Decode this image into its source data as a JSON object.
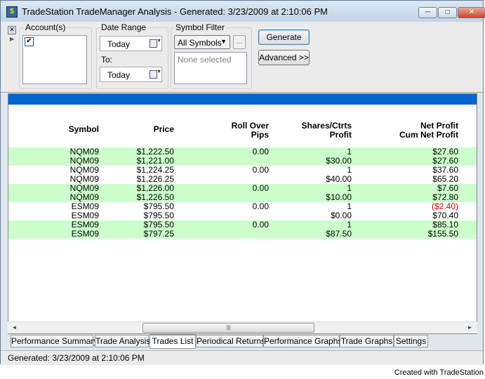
{
  "window": {
    "title": "TradeStation TradeManager Analysis - Generated: 3/23/2009 at 2:10:06 PM"
  },
  "toolbar": {
    "accounts_label": "Account(s)",
    "date_range_label": "Date Range",
    "from_value": "Today",
    "to_label": "To:",
    "to_value": "Today",
    "symbol_filter_label": "Symbol Filter",
    "symbol_filter_value": "All Symbols",
    "ellipsis_label": "...",
    "selected_text": "None selected",
    "generate_label": "Generate",
    "advanced_label": "Advanced >>"
  },
  "table": {
    "headers": [
      {
        "line1": "",
        "line2": "Symbol"
      },
      {
        "line1": "",
        "line2": "Price"
      },
      {
        "line1": "Roll Over",
        "line2": "Pips"
      },
      {
        "line1": "Shares/Ctrts",
        "line2": "Profit"
      },
      {
        "line1": "Net Profit",
        "line2": "Cum Net Profit"
      }
    ],
    "rows": [
      {
        "symbol": "NQM09",
        "price": "$1,222.50",
        "rollover": "0.00",
        "shares_profit": "1",
        "net": "$27.60",
        "green": true
      },
      {
        "symbol": "NQM09",
        "price": "$1,221.00",
        "rollover": "",
        "shares_profit": "$30.00",
        "net": "$27.60",
        "green": true
      },
      {
        "symbol": "NQM09",
        "price": "$1,224.25",
        "rollover": "0.00",
        "shares_profit": "1",
        "net": "$37.60",
        "green": false
      },
      {
        "symbol": "NQM09",
        "price": "$1,226.25",
        "rollover": "",
        "shares_profit": "$40.00",
        "net": "$65.20",
        "green": false
      },
      {
        "symbol": "NQM09",
        "price": "$1,226.00",
        "rollover": "0.00",
        "shares_profit": "1",
        "net": "$7.60",
        "green": true
      },
      {
        "symbol": "NQM09",
        "price": "$1,226.50",
        "rollover": "",
        "shares_profit": "$10.00",
        "net": "$72.80",
        "green": true
      },
      {
        "symbol": "ESM09",
        "price": "$795.50",
        "rollover": "0.00",
        "shares_profit": "1",
        "net": "($2.40)",
        "green": false,
        "negative": true
      },
      {
        "symbol": "ESM09",
        "price": "$795.50",
        "rollover": "",
        "shares_profit": "$0.00",
        "net": "$70.40",
        "green": false
      },
      {
        "symbol": "ESM09",
        "price": "$795.50",
        "rollover": "0.00",
        "shares_profit": "1",
        "net": "$85.10",
        "green": true
      },
      {
        "symbol": "ESM09",
        "price": "$797.25",
        "rollover": "",
        "shares_profit": "$87.50",
        "net": "$155.50",
        "green": true
      }
    ]
  },
  "scrollbar": {
    "left_arrow": "◄",
    "right_arrow": "►",
    "grip": "|||"
  },
  "tabs": [
    {
      "label": "Performance Summary",
      "active": false
    },
    {
      "label": "Trade Analysis",
      "active": false
    },
    {
      "label": "Trades List",
      "active": true
    },
    {
      "label": "Periodical Returns",
      "active": false
    },
    {
      "label": "Performance Graphs",
      "active": false
    },
    {
      "label": "Trade Graphs",
      "active": false
    },
    {
      "label": "Settings",
      "active": false
    }
  ],
  "status": {
    "text": "Generated: 3/23/2009 at 2:10:06 PM"
  },
  "credit": "Created with TradeStation",
  "colors": {
    "header_band": "#0066cc",
    "row_highlight": "#ccffcc",
    "negative": "#e00000"
  }
}
